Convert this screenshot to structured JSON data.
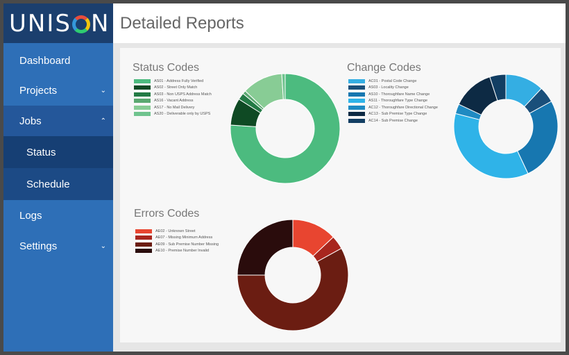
{
  "app": {
    "logo_text_left": "UNIS",
    "logo_text_right": "N"
  },
  "header": {
    "title": "Detailed Reports"
  },
  "sidebar": {
    "items": [
      {
        "label": "Dashboard",
        "chevron": ""
      },
      {
        "label": "Projects",
        "chevron": "⌄"
      },
      {
        "label": "Jobs",
        "chevron": "⌃"
      },
      {
        "label": "Status",
        "chevron": ""
      },
      {
        "label": "Schedule",
        "chevron": ""
      },
      {
        "label": "Logs",
        "chevron": ""
      },
      {
        "label": "Settings",
        "chevron": "⌄"
      }
    ]
  },
  "sections": {
    "status": {
      "title": "Status Codes"
    },
    "change": {
      "title": "Change Codes"
    },
    "errors": {
      "title": "Errors Codes"
    }
  },
  "chart_data": [
    {
      "type": "pie",
      "title": "Status Codes",
      "donut": true,
      "start_angle": 0,
      "series": [
        {
          "name": "AS01 - Address Fully Verified",
          "value": 76,
          "color": "#4cbb7f"
        },
        {
          "name": "AS02 - Street Only Match",
          "value": 8,
          "color": "#0f4a24"
        },
        {
          "name": "AS03 - Non USPS Address Match",
          "value": 2,
          "color": "#237a45"
        },
        {
          "name": "AS16 - Vacant Address",
          "value": 1,
          "color": "#5aa870"
        },
        {
          "name": "AS17 - No Mail Delivery",
          "value": 12,
          "color": "#88cc95"
        },
        {
          "name": "AS20 - Deliverable only by USPS",
          "value": 1,
          "color": "#6fc38e"
        }
      ]
    },
    {
      "type": "pie",
      "title": "Change Codes",
      "donut": true,
      "start_angle": 0,
      "series": [
        {
          "name": "AC01 - Postal Code Change",
          "value": 12,
          "color": "#34aee3"
        },
        {
          "name": "AS03 - Locality Change",
          "value": 5,
          "color": "#1a4f7a"
        },
        {
          "name": "AS10 - Thoroughfare Name Change",
          "value": 26,
          "color": "#1777b0"
        },
        {
          "name": "AS11 - Thoroughfare Type Change",
          "value": 36,
          "color": "#2fb3e8"
        },
        {
          "name": "AC12 - Thoroughfare Directional Change",
          "value": 3,
          "color": "#1f8ac2"
        },
        {
          "name": "AC13 - Sub Premise Type Change",
          "value": 13,
          "color": "#0d2a44"
        },
        {
          "name": "AC14 - Sub Premise Change",
          "value": 5,
          "color": "#123e63"
        }
      ]
    },
    {
      "type": "pie",
      "title": "Errors Codes",
      "donut": true,
      "start_angle": 0,
      "series": [
        {
          "name": "AE02 - Unknown Street",
          "value": 13,
          "color": "#e84530"
        },
        {
          "name": "AE07 - Missing Minimum Address",
          "value": 4,
          "color": "#a8261e"
        },
        {
          "name": "AE09 - Sub Premise Number Missing",
          "value": 58,
          "color": "#6b1d12"
        },
        {
          "name": "AE10 - Premise Number Invalid",
          "value": 25,
          "color": "#2a0c0c"
        }
      ]
    }
  ]
}
